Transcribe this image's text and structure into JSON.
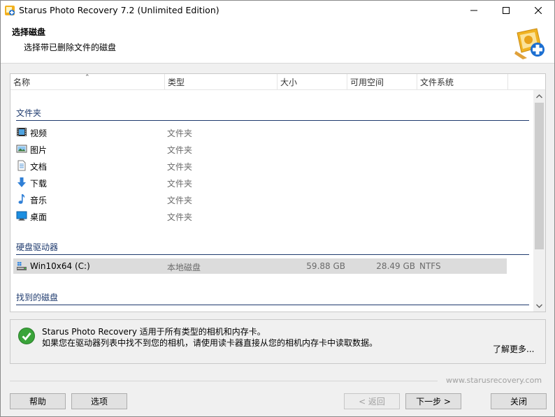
{
  "window": {
    "title": "Starus Photo Recovery 7.2 (Unlimited Edition)"
  },
  "header": {
    "title": "选择磁盘",
    "subtitle": "选择带已删除文件的磁盘"
  },
  "columns": {
    "name": "名称",
    "type": "类型",
    "size": "大小",
    "free": "可用空间",
    "fs": "文件系统"
  },
  "groups": {
    "folders": "文件夹",
    "drives": "硬盘驱动器",
    "found": "找到的磁盘"
  },
  "folders": [
    {
      "name": "视频",
      "type": "文件夹",
      "icon": "video-icon"
    },
    {
      "name": "图片",
      "type": "文件夹",
      "icon": "picture-icon"
    },
    {
      "name": "文档",
      "type": "文件夹",
      "icon": "document-icon"
    },
    {
      "name": "下载",
      "type": "文件夹",
      "icon": "download-icon"
    },
    {
      "name": "音乐",
      "type": "文件夹",
      "icon": "music-icon"
    },
    {
      "name": "桌面",
      "type": "文件夹",
      "icon": "desktop-icon"
    }
  ],
  "drives": [
    {
      "name": "Win10x64 (C:)",
      "type": "本地磁盘",
      "size": "59.88 GB",
      "free": "28.49 GB",
      "fs": "NTFS",
      "icon": "drive-icon"
    }
  ],
  "info": {
    "line1": "Starus Photo Recovery 适用于所有类型的相机和内存卡。",
    "line2": "如果您在驱动器列表中找不到您的相机，请使用读卡器直接从您的相机内存卡中读取数据。",
    "more": "了解更多..."
  },
  "website": "www.starusrecovery.com",
  "buttons": {
    "help": "帮助",
    "options": "选项",
    "back": "< 返回",
    "next": "下一步 >",
    "close": "关闭"
  },
  "colors": {
    "group_text": "#1e3a6e",
    "selected_row": "#dcdcdc",
    "check_green": "#3aa43a"
  }
}
